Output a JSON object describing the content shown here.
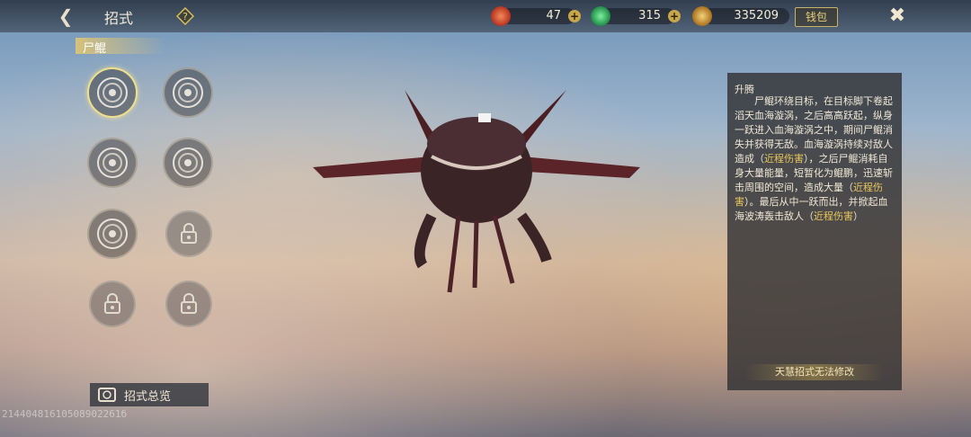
{
  "header": {
    "title": "招式",
    "resources": [
      {
        "icon": "red-gem-icon",
        "value": "47",
        "color": "#c4432c"
      },
      {
        "icon": "green-jade-icon",
        "value": "315",
        "color": "#2fa25a"
      },
      {
        "icon": "gold-ingot-icon",
        "value": "335209",
        "color": "#c9952e"
      }
    ],
    "wallet_label": "钱包"
  },
  "character_tab": "尸鲲",
  "skills": [
    {
      "state": "unlocked",
      "selected": true
    },
    {
      "state": "unlocked",
      "selected": false
    },
    {
      "state": "unlocked",
      "selected": false
    },
    {
      "state": "unlocked",
      "selected": false
    },
    {
      "state": "unlocked",
      "selected": false
    },
    {
      "state": "locked",
      "selected": false
    },
    {
      "state": "locked",
      "selected": false
    },
    {
      "state": "locked",
      "selected": false
    }
  ],
  "overview_label": "招式总览",
  "watermark": "21440481610508902261б",
  "detail": {
    "name": "升腾",
    "desc_1": "尸鲲环绕目标，在目标脚下卷起滔天血海漩涡，之后高高跃起，纵身一跃进入血海漩涡之中，期间尸鲲消失并获得无敌。血海漩涡持续对敌人造成（",
    "hl_1": "近程伤害",
    "desc_2": "），之后尸鲲消耗自身大量能量，短暂化为鲲鹏，迅速斩击周围的空间，造成大量（",
    "hl_2": "近程伤害",
    "desc_3": "）。最后从中一跃而出，并掀起血海波涛轰击敌人（",
    "hl_3": "近程伤害",
    "desc_4": "）",
    "note": "天慧招式无法修改"
  }
}
